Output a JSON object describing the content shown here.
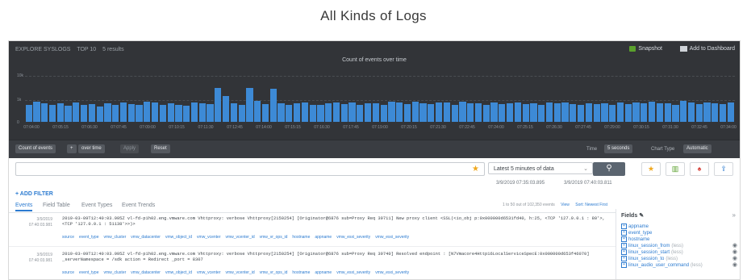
{
  "caption": "All Kinds of Logs",
  "chart": {
    "topbar": [
      "EXPLORE SYSLOGS",
      "TOP 10",
      "5 results"
    ],
    "title": "Count of events over time",
    "snapshot_label": "Snapshot",
    "add_dashboard_label": "Add to Dashboard",
    "y_ticks": [
      "10k",
      "1k",
      "0"
    ],
    "x_ticks": [
      "07:04:00",
      "07:05:15",
      "07:06:30",
      "07:07:45",
      "07:09:00",
      "07:10:15",
      "07:11:30",
      "07:12:45",
      "07:14:00",
      "07:15:15",
      "07:16:30",
      "07:17:45",
      "07:19:00",
      "07:20:15",
      "07:21:30",
      "07:22:45",
      "07:24:00",
      "07:25:15",
      "07:26:30",
      "07:27:45",
      "07:29:00",
      "07:30:15",
      "07:31:30",
      "07:32:45",
      "07:34:00"
    ]
  },
  "chart_data": {
    "type": "bar",
    "title": "Count of events over time",
    "ylabel": "",
    "xlabel": "",
    "yscale": "log",
    "ylim": [
      1,
      10000
    ],
    "values": [
      30,
      55,
      38,
      28,
      42,
      25,
      48,
      30,
      36,
      22,
      40,
      30,
      52,
      35,
      28,
      58,
      45,
      30,
      40,
      32,
      26,
      48,
      40,
      33,
      900,
      180,
      40,
      30,
      950,
      70,
      36,
      700,
      44,
      32,
      40,
      52,
      30,
      28,
      38,
      46,
      34,
      52,
      30,
      44,
      38,
      30,
      56,
      48,
      36,
      60,
      40,
      34,
      46,
      50,
      32,
      58,
      42,
      38,
      30,
      48,
      36,
      44,
      50,
      34,
      40,
      30,
      52,
      38,
      46,
      36,
      30,
      40,
      34,
      44,
      30,
      48,
      36,
      52,
      42,
      60,
      38,
      44,
      30,
      64,
      46,
      34,
      48,
      40,
      36,
      52
    ]
  },
  "toolbar": {
    "count_label": "Count of events",
    "over_time_label": "over time",
    "apply_label": "Apply",
    "reset_label": "Reset",
    "time_label": "Time",
    "interval_label": "5 seconds",
    "chart_type_label": "Chart Type",
    "chart_type_value": "Automatic"
  },
  "search": {
    "placeholder": "",
    "time_range": "Latest 5 minutes of data",
    "go_icon": "search-icon",
    "range_from": "3/9/2019 07:35:03.895",
    "range_to": "3/9/2019 07:40:03.811"
  },
  "add_filter": "+ ADD FILTER",
  "tabs": [
    "Events",
    "Field Table",
    "Event Types",
    "Event Trends"
  ],
  "events_meta": {
    "summary": "1 to 50 out of 102,350 events",
    "view_label": "View",
    "sort_label": "Sort: Newest First"
  },
  "events": [
    {
      "time": "3/9/2019 07:40:03.981",
      "text": "2019-03-09T12:40:03.995Z vl-fd-p1h02.eng.vmware.com Vhttproxy: verbose Vhttproxy[2150254] [Originator@6876 sub=Proxy Req 39711] New proxy client <SSL(<io_obj p:0x000000d6531fd40, h:25, <TCP '127.0.0.1 : 80'>, <TCP '127.0.0.1 : 51138'>>)>",
      "tags": [
        "source",
        "event_type",
        "vmw_cluster",
        "vmw_datacenter",
        "vmw_object_id",
        "vmw_vcenter",
        "vmw_vcenter_id",
        "vmw_vr_ops_id",
        "hostname",
        "appname",
        "vmw_esxi_severity",
        "vmw_esxi_severity"
      ]
    },
    {
      "time": "3/9/2019 07:40:03.981",
      "text": "2019-03-09T12:40:03.995Z vl-fd-p1h02.eng.vmware.com Vhttproxy: verbose Vhttproxy[2150254] [Originator@6876 sub=Proxy Req 39740] Resolved endpoint : [N7Vmacore4Http16LocalServiceSpecE:0x000000d653f46070] _serverNamespace = /sdk action = Redirect _port = 8307",
      "tags": [
        "source",
        "event_type",
        "vmw_cluster",
        "vmw_datacenter",
        "vmw_object_id",
        "vmw_vcenter",
        "vmw_vcenter_id",
        "vmw_vr_ops_id",
        "hostname",
        "appname",
        "vmw_esxi_severity",
        "vmw_esxi_severity"
      ]
    }
  ],
  "fields": {
    "title": "Fields",
    "items": [
      {
        "name": "appname",
        "count": ""
      },
      {
        "name": "event_type",
        "count": ""
      },
      {
        "name": "hostname",
        "count": ""
      },
      {
        "name": "linux_session_from",
        "count": "(less)"
      },
      {
        "name": "linux_session_start",
        "count": "(less)"
      },
      {
        "name": "linux_session_to",
        "count": "(less)"
      },
      {
        "name": "linux_audio_user_command",
        "count": "(less)"
      }
    ]
  }
}
